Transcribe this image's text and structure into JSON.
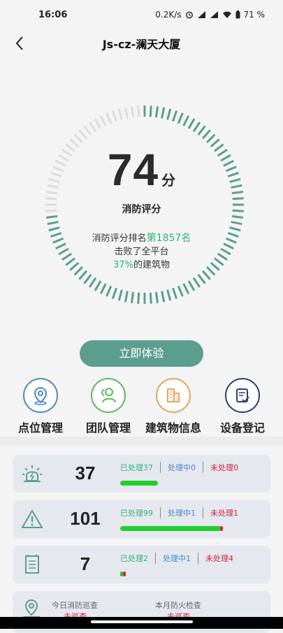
{
  "status_bar": {
    "time": "16:06",
    "network_speed": "0.2K/s",
    "battery": "71 %"
  },
  "header": {
    "title": "Js-cz-澜天大厦"
  },
  "score": {
    "value": "74",
    "unit": "分",
    "label": "消防评分",
    "gauge_fraction": 0.74,
    "rank_prefix": "消防评分排名",
    "rank_value": "第1857名",
    "beat_text": "击败了全平台",
    "beat_percent": "37%",
    "beat_suffix": "的建筑物"
  },
  "colors": {
    "accent": "#5c9e8d",
    "green": "#2bb673",
    "blue": "#4a87c5",
    "red": "#c9263f",
    "gauge_inactive": "#dcdcdc"
  },
  "actions": {
    "try_label": "立即体验"
  },
  "shortcuts": [
    {
      "label": "点位管理",
      "icon": "location-pin-icon",
      "color": "#4a87c5"
    },
    {
      "label": "团队管理",
      "icon": "team-icon",
      "color": "#5cb85c"
    },
    {
      "label": "建筑物信息",
      "icon": "building-icon",
      "color": "#e8a35c"
    },
    {
      "label": "设备登记",
      "icon": "checklist-icon",
      "color": "#2c3e70"
    }
  ],
  "stats": [
    {
      "icon": "alarm-light-icon",
      "count": "37",
      "done": "已处理37",
      "in_progress": "处理中0",
      "pending": "未处理0",
      "done_fraction": 1.0,
      "pending_fraction": 0.0
    },
    {
      "icon": "warning-triangle-icon",
      "count": "101",
      "done": "已处理99",
      "in_progress": "处理中1",
      "pending": "未处理1",
      "done_fraction": 0.98,
      "pending_fraction": 0.02
    },
    {
      "icon": "document-icon",
      "count": "7",
      "done": "已处理2",
      "in_progress": "处理中1",
      "pending": "未处理4",
      "done_fraction": 0.29,
      "pending_fraction": 0.57
    }
  ],
  "patrol": {
    "icon": "location-person-icon",
    "today_label": "今日消防巡查",
    "today_value": "未巡查",
    "month_label": "本月防火检查",
    "month_value": "未巡查"
  }
}
